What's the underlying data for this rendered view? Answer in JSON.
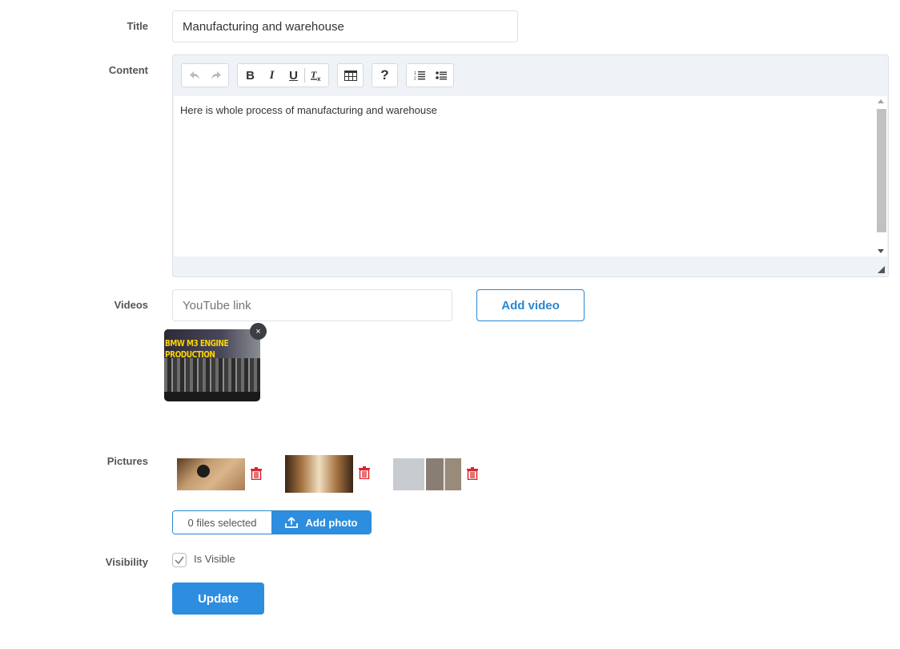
{
  "form": {
    "title": {
      "label": "Title",
      "value": "Manufacturing and warehouse"
    },
    "content": {
      "label": "Content",
      "toolbar": {
        "undo_icon": "undo-icon",
        "redo_icon": "redo-icon",
        "bold": "B",
        "italic": "I",
        "underline": "U",
        "clear_format": "Tx",
        "table_icon": "table-icon",
        "help": "?",
        "ordered_list_icon": "ordered-list-icon",
        "unordered_list_icon": "unordered-list-icon"
      },
      "body": "Here is whole process of manufacturing and warehouse"
    },
    "videos": {
      "label": "Videos",
      "placeholder": "YouTube link",
      "value": "",
      "add_button": "Add video",
      "items": [
        {
          "caption": "BMW M3 ENGINE\nPRODUCTION",
          "remove_icon": "close-icon",
          "remove_glyph": "×"
        }
      ]
    },
    "pictures": {
      "label": "Pictures",
      "items": [
        {
          "description": "packing boxes with tape gun",
          "delete_icon": "trash-icon"
        },
        {
          "description": "warehouse aisle with shelves",
          "delete_icon": "trash-icon"
        },
        {
          "description": "warehouse collage",
          "delete_icon": "trash-icon"
        }
      ],
      "files_selected": "0 files selected",
      "add_button": "Add photo",
      "upload_icon": "upload-icon"
    },
    "visibility": {
      "label": "Visibility",
      "checkbox_label": "Is Visible",
      "checked": true
    },
    "submit": "Update"
  },
  "colors": {
    "accent": "#2d8ee0",
    "danger": "#d9262c",
    "editor_bg": "#eff2f7"
  }
}
